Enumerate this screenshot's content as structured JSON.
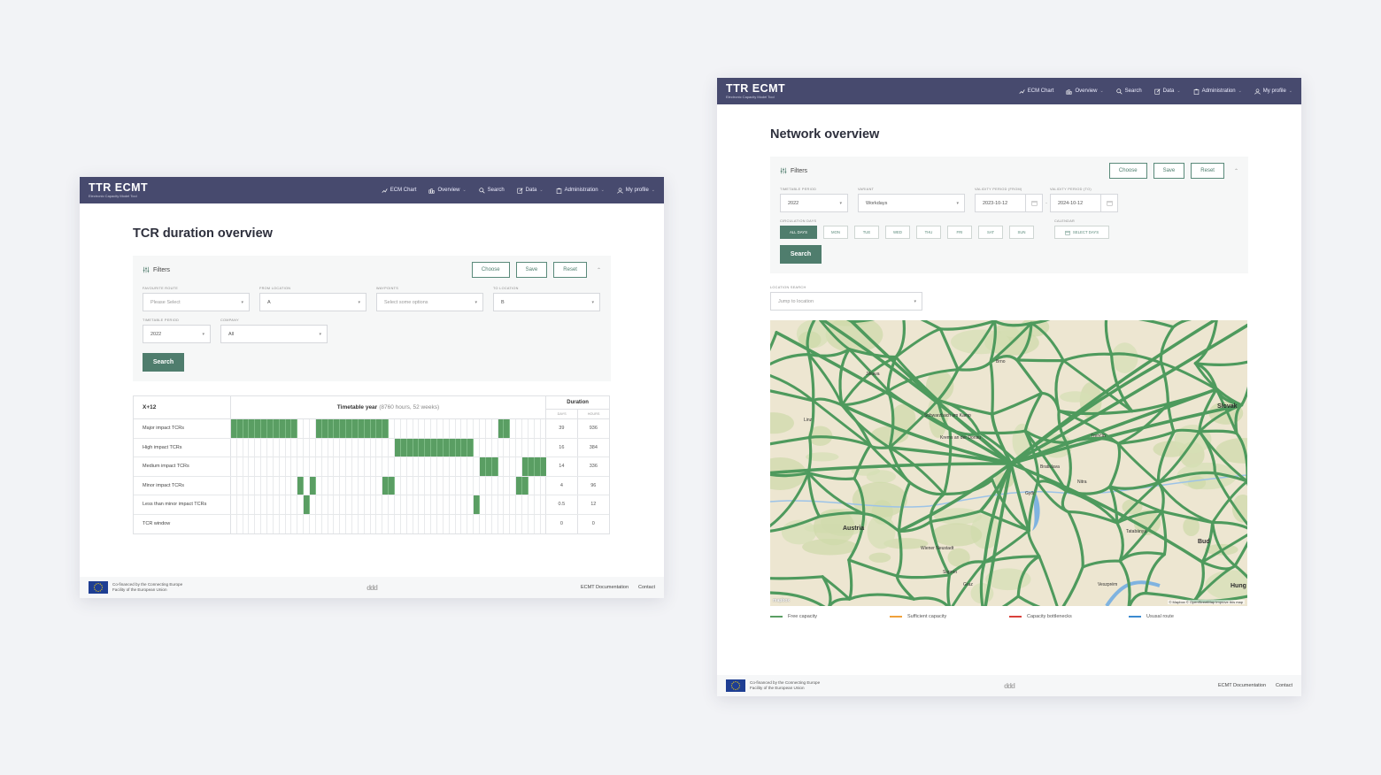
{
  "nav": {
    "brand": "TTR ECMT",
    "tagline": "Electronic Capacity Model Tool",
    "items": [
      {
        "label": "ECM Chart",
        "icon": "chart-icon",
        "dropdown": false
      },
      {
        "label": "Overview",
        "icon": "bar-chart-icon",
        "dropdown": true
      },
      {
        "label": "Search",
        "icon": "search-icon",
        "dropdown": false
      },
      {
        "label": "Data",
        "icon": "edit-icon",
        "dropdown": true
      },
      {
        "label": "Administration",
        "icon": "clipboard-icon",
        "dropdown": true
      },
      {
        "label": "My profile",
        "icon": "user-icon",
        "dropdown": true
      }
    ]
  },
  "tcr_page": {
    "title": "TCR duration overview",
    "filters": {
      "title": "Filters",
      "choose": "Choose",
      "save": "Save",
      "reset": "Reset",
      "favourite_route": {
        "label": "FAVOURITE ROUTE",
        "value": "Please Select"
      },
      "from_location": {
        "label": "FROM LOCATION",
        "value": "A"
      },
      "waypoints": {
        "label": "WAYPOINTS",
        "value": "Select some options"
      },
      "to_location": {
        "label": "TO LOCATION",
        "value": "B"
      },
      "timetable_period": {
        "label": "TIMETABLE PERIOD",
        "value": "2022"
      },
      "company": {
        "label": "COMPANY",
        "value": "All"
      },
      "search": "Search"
    },
    "table": {
      "corner": "X+12",
      "year_title": "Timetable year",
      "year_sub": "(8760 hours, 52 weeks)",
      "duration": "Duration",
      "days_label": "DAYS",
      "hours_label": "HOURS",
      "rows": [
        {
          "label": "Major impact TCRs",
          "days": "39",
          "hours": "936",
          "weeks": [
            1,
            2,
            3,
            4,
            5,
            6,
            7,
            8,
            9,
            10,
            11,
            15,
            16,
            17,
            18,
            19,
            20,
            21,
            22,
            23,
            24,
            25,
            26,
            45,
            46
          ]
        },
        {
          "label": "High impact TCRs",
          "days": "16",
          "hours": "384",
          "weeks": [
            28,
            29,
            30,
            31,
            32,
            33,
            34,
            35,
            36,
            37,
            38,
            39,
            40
          ]
        },
        {
          "label": "Medium impact TCRs",
          "days": "14",
          "hours": "336",
          "weeks": [
            42,
            43,
            44,
            49,
            50,
            51,
            52
          ]
        },
        {
          "label": "Minor impact TCRs",
          "days": "4",
          "hours": "96",
          "weeks": [
            12,
            14,
            26,
            27,
            48,
            49
          ]
        },
        {
          "label": "Less than minor impact TCRs",
          "days": "0.5",
          "hours": "12",
          "weeks": [
            13,
            41
          ]
        },
        {
          "label": "TCR window",
          "days": "0",
          "hours": "0",
          "weeks": []
        }
      ]
    }
  },
  "network_page": {
    "title": "Network overview",
    "filters": {
      "title": "Filters",
      "choose": "Choose",
      "save": "Save",
      "reset": "Reset",
      "timetable_period": {
        "label": "TIMETABLE PERIOD",
        "value": "2022"
      },
      "variant": {
        "label": "VARIANT",
        "value": "Workdays"
      },
      "validity_from": {
        "label": "VALIDITY PERIOD (FROM)",
        "value": "2023-10-12"
      },
      "validity_to": {
        "label": "VALIDITY PERIOD (TO)",
        "value": "2024-10-12"
      },
      "date_sep": "-",
      "circulation_days_label": "CIRCULATION DAYS",
      "days": [
        "ALL DAYS",
        "MON",
        "TUE",
        "WED",
        "THU",
        "FRI",
        "SAT",
        "SUN"
      ],
      "active_day": "ALL DAYS",
      "calendar_label": "CALENDAR",
      "select_days": "SELECT DAYS",
      "search": "Search"
    },
    "location_search": {
      "label": "LOCATION SEARCH",
      "placeholder": "Jump to location"
    },
    "map": {
      "labels": [
        {
          "text": "Austria",
          "big": true
        },
        {
          "text": "Bratislava",
          "big": false
        },
        {
          "text": "Slovak",
          "big": true
        },
        {
          "text": "Bud",
          "big": true
        },
        {
          "text": "Hung",
          "big": true
        },
        {
          "text": "Schwarzbach am Kamp",
          "big": false
        },
        {
          "text": "Krems an der Donau",
          "big": false
        },
        {
          "text": "Brno",
          "big": false
        },
        {
          "text": "Trenčín",
          "big": false
        },
        {
          "text": "Nitra",
          "big": false
        },
        {
          "text": "Győr",
          "big": false
        },
        {
          "text": "Tatabánya",
          "big": false
        },
        {
          "text": "Veszprém",
          "big": false
        },
        {
          "text": "Graz",
          "big": false
        },
        {
          "text": "Wiener Neustadt",
          "big": false
        },
        {
          "text": "Sopron",
          "big": false
        },
        {
          "text": "Jihlava",
          "big": false
        },
        {
          "text": "Linz",
          "big": false
        }
      ],
      "attribution": "© Mapbox © OpenStreetMap  Improve this map",
      "logo": "mapbox"
    },
    "legend": [
      {
        "label": "Free capacity",
        "color": "#5a9e63"
      },
      {
        "label": "Sufficient capacity",
        "color": "#f0a13a"
      },
      {
        "label": "Capacity bottlenecks",
        "color": "#d9413b"
      },
      {
        "label": "Ususal route",
        "color": "#3b8ad0"
      }
    ]
  },
  "footer": {
    "eu_line1": "Co-financed by the Connecting Europe",
    "eu_line2": "Facility of the European Union",
    "logo_text": "ddd",
    "doc_link": "ECMT Documentation",
    "contact_link": "Contact"
  },
  "colors": {
    "nav_bg": "#474a6e",
    "accent": "#4f7d6d",
    "tcr_fill": "#5a9e63",
    "map_line": "#4e9a5d"
  }
}
